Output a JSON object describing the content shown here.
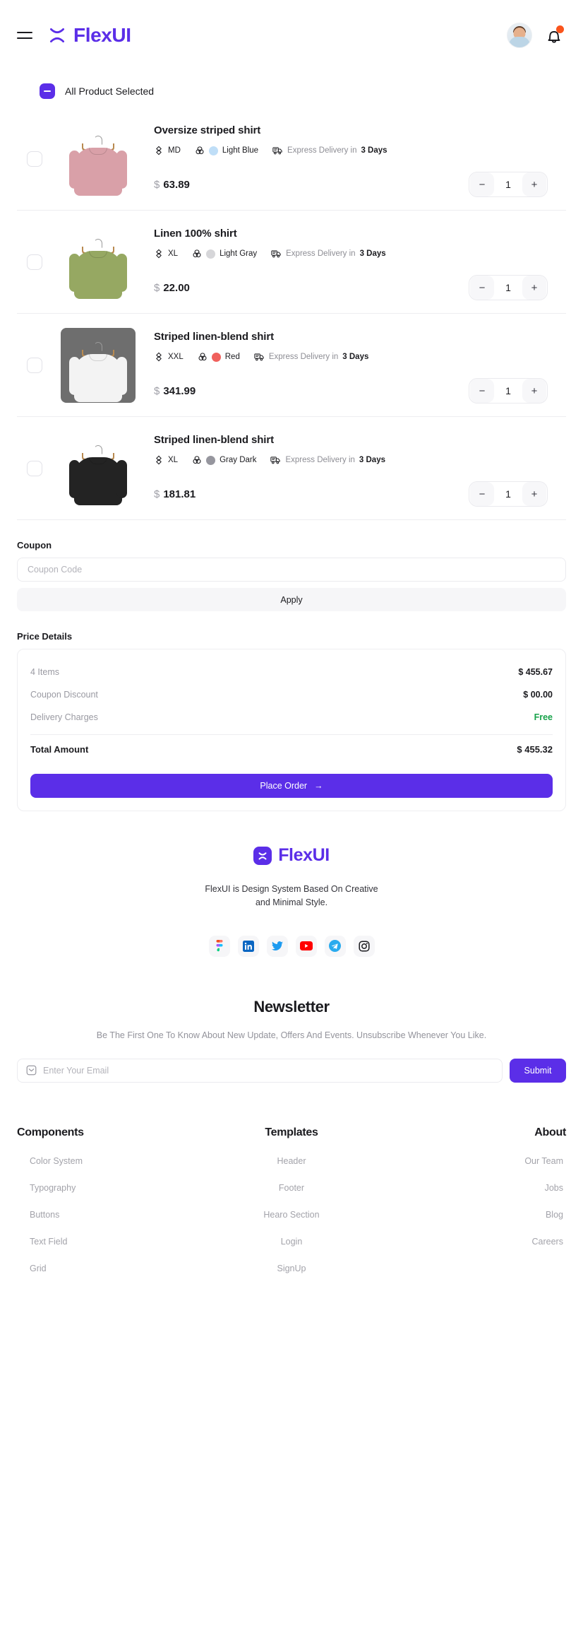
{
  "header": {
    "menu_icon": "hamburger-icon",
    "brand": "FlexUI",
    "avatar_icon": "user-avatar",
    "bell_icon": "bell-icon",
    "has_notification": true
  },
  "cart": {
    "select_all_label": "All Product Selected",
    "select_all_state": "indeterminate",
    "products": [
      {
        "title": "Oversize striped shirt",
        "size": "MD",
        "color_name": "Light Blue",
        "color_hex": "#BFDEF7",
        "delivery_prefix": "Express Delivery in",
        "delivery_days": "3 Days",
        "currency": "$",
        "price": "63.89",
        "qty": "1",
        "garment_hex": "#D9A0A8",
        "bg": "white"
      },
      {
        "title": "Linen 100% shirt",
        "size": "XL",
        "color_name": "Light Gray",
        "color_hex": "#D6D6D9",
        "delivery_prefix": "Express Delivery in",
        "delivery_days": "3 Days",
        "currency": "$",
        "price": "22.00",
        "qty": "1",
        "garment_hex": "#96A862",
        "bg": "white"
      },
      {
        "title": "Striped linen-blend shirt",
        "size": "XXL",
        "color_name": "Red",
        "color_hex": "#F0605C",
        "delivery_prefix": "Express Delivery in",
        "delivery_days": "3 Days",
        "currency": "$",
        "price": "341.99",
        "qty": "1",
        "garment_hex": "#F3F3F3",
        "bg": "dark"
      },
      {
        "title": "Striped linen-blend shirt",
        "size": "XL",
        "color_name": "Gray Dark",
        "color_hex": "#96969E",
        "delivery_prefix": "Express Delivery in",
        "delivery_days": "3 Days",
        "currency": "$",
        "price": "181.81",
        "qty": "1",
        "garment_hex": "#232323",
        "bg": "white"
      }
    ],
    "stepper": {
      "minus": "−",
      "plus": "+"
    }
  },
  "coupon": {
    "title": "Coupon",
    "placeholder": "Coupon Code",
    "value": "",
    "apply_label": "Apply"
  },
  "price_details": {
    "title": "Price Details",
    "rows": [
      {
        "label": "4 Items",
        "value": "$ 455.67",
        "free": false
      },
      {
        "label": "Coupon Discount",
        "value": "$ 00.00",
        "free": false
      },
      {
        "label": "Delivery Charges",
        "value": "Free",
        "free": true
      }
    ],
    "total_label": "Total Amount",
    "total_value": "$ 455.32",
    "place_order_label": "Place Order",
    "place_order_arrow": "→"
  },
  "footer": {
    "brand": "FlexUI",
    "tagline_line1": "FlexUI is Design System Based On Creative",
    "tagline_line2": "and Minimal Style.",
    "socials": [
      {
        "name": "figma-icon"
      },
      {
        "name": "linkedin-icon"
      },
      {
        "name": "twitter-icon"
      },
      {
        "name": "youtube-icon"
      },
      {
        "name": "telegram-icon"
      },
      {
        "name": "instagram-icon"
      }
    ],
    "newsletter": {
      "title": "Newsletter",
      "subtitle": "Be The First One To Know  About New Update, Offers And Events. Unsubscribe Whenever You Like.",
      "email_placeholder": "Enter Your Email",
      "email_value": "",
      "submit_label": "Submit",
      "mail_icon": "mail-icon"
    },
    "columns": [
      {
        "heading": "Components",
        "links": [
          "Color System",
          "Typography",
          "Buttons",
          "Text Field",
          "Grid"
        ]
      },
      {
        "heading": "Templates",
        "links": [
          "Header",
          "Footer",
          "Hearo Section",
          "Login",
          "SignUp"
        ]
      },
      {
        "heading": "About",
        "links": [
          "Our Team",
          "Jobs",
          "Blog",
          "Careers"
        ]
      }
    ]
  },
  "colors": {
    "accent": "#5B2EE8",
    "free_green": "#17A24A",
    "notification": "#FA541C",
    "muted": "#9A9AA2"
  }
}
